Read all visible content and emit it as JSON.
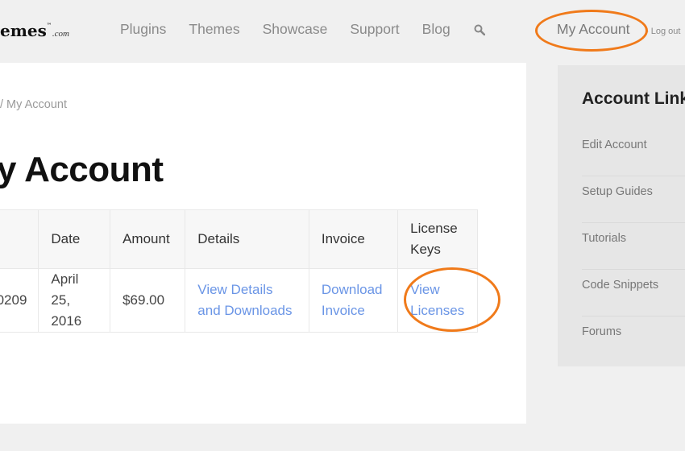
{
  "header": {
    "logo_text": "emes",
    "logo_tm": "™",
    "logo_domain": ".com",
    "nav": [
      {
        "label": "Plugins"
      },
      {
        "label": "Themes"
      },
      {
        "label": "Showcase"
      },
      {
        "label": "Support"
      },
      {
        "label": "Blog"
      }
    ],
    "search_icon": "search-icon",
    "account_label": "My Account",
    "logout_label": "Log out"
  },
  "main": {
    "breadcrumb": "/ My Account",
    "page_title": "y Account",
    "table": {
      "headers": [
        "",
        "Date",
        "Amount",
        "Details",
        "Invoice",
        "License Keys"
      ],
      "rows": [
        {
          "order": "0209",
          "date": "April 25, 2016",
          "amount": "$69.00",
          "details": "View Details and Downloads",
          "invoice": "Download Invoice",
          "licenses": "View Licenses"
        }
      ]
    }
  },
  "sidebar": {
    "title": "Account Links",
    "items": [
      {
        "label": "Edit Account"
      },
      {
        "label": "Setup Guides"
      },
      {
        "label": "Tutorials"
      },
      {
        "label": "Code Snippets"
      },
      {
        "label": "Forums"
      }
    ]
  },
  "colors": {
    "highlight": "#f07a1a",
    "link": "#6a95e6"
  }
}
